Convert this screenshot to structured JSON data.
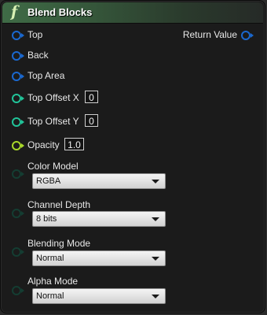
{
  "node": {
    "title": "Blend Blocks",
    "function_icon": "function-f-icon",
    "header_color": "#3f6b46"
  },
  "pins": {
    "top": "Top",
    "back": "Back",
    "top_area": "Top Area",
    "top_offset_x": {
      "label": "Top Offset X",
      "value": "0"
    },
    "top_offset_y": {
      "label": "Top Offset Y",
      "value": "0"
    },
    "opacity": {
      "label": "Opacity",
      "value": "1.0"
    },
    "return_value": "Return Value"
  },
  "options": {
    "color_model": {
      "label": "Color Model",
      "value": "RGBA"
    },
    "channel_depth": {
      "label": "Channel Depth",
      "value": "8 bits"
    },
    "blending_mode": {
      "label": "Blending Mode",
      "value": "Normal"
    },
    "alpha_mode": {
      "label": "Alpha Mode",
      "value": "Normal"
    }
  },
  "colors": {
    "object_pin": "#1a68cf",
    "int_pin": "#21c499",
    "float_pin": "#a9d82a",
    "enum_pin": "#143d32"
  }
}
